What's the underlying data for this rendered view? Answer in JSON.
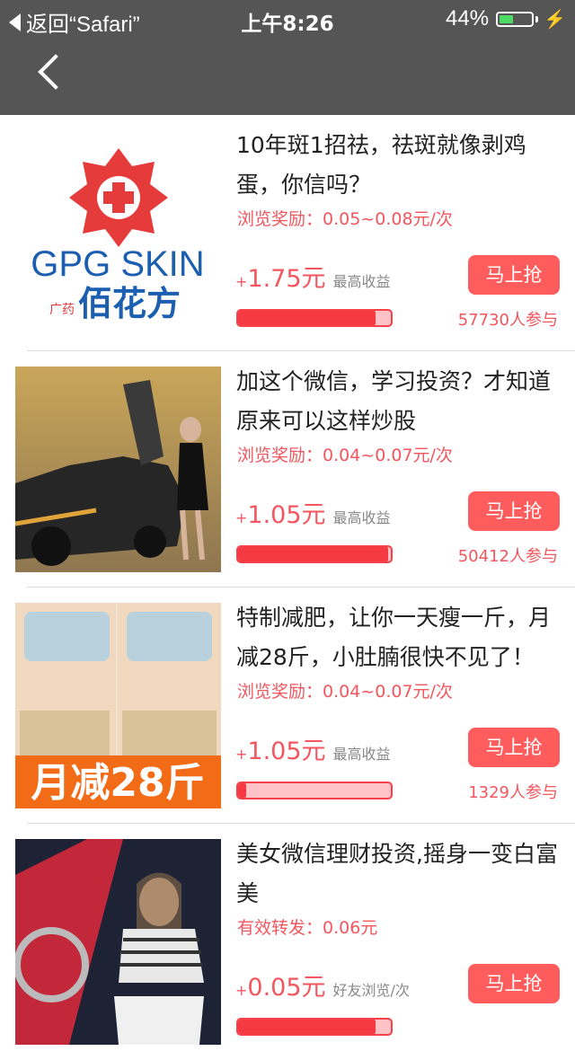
{
  "status_bar": {
    "back_label": "返回“Safari”",
    "time": "上午8:26",
    "battery": "44%",
    "battery_level": 0.44
  },
  "nav": {
    "back_icon": "chevron-left-icon"
  },
  "items": [
    {
      "title": "10年斑1招祛，祛斑就像剥鸡蛋，你信吗？",
      "reward": "浏览奖励：0.05~0.08元/次",
      "plus": "+",
      "amount": "1.75元",
      "amount_label": "最高收益",
      "button": "马上抢",
      "participants": "57730人参与",
      "progress": 0.9,
      "logo_text_1": "GPG SKIN",
      "logo_text_2": "佰花方",
      "logo_text_small": "广药"
    },
    {
      "title": "加这个微信，学习投资？才知道原来可以这样炒股",
      "reward": "浏览奖励：0.04~0.07元/次",
      "plus": "+",
      "amount": "1.05元",
      "amount_label": "最高收益",
      "button": "马上抢",
      "participants": "50412人参与",
      "progress": 0.98
    },
    {
      "title": "特制减肥，让你一天瘦一斤，月减28斤，小肚腩很快不见了！",
      "reward": "浏览奖励：0.04~0.07元/次",
      "plus": "+",
      "amount": "1.05元",
      "amount_label": "最高收益",
      "button": "马上抢",
      "participants": "1329人参与",
      "progress": 0.05,
      "banner": "月减28斤"
    },
    {
      "title": "美女微信理财投资,摇身一变白富美",
      "reward": "有效转发：0.06元",
      "plus": "+",
      "amount": "0.05元",
      "amount_label": "好友浏览/次",
      "button": "马上抢",
      "participants": "",
      "progress": 0.9
    }
  ]
}
